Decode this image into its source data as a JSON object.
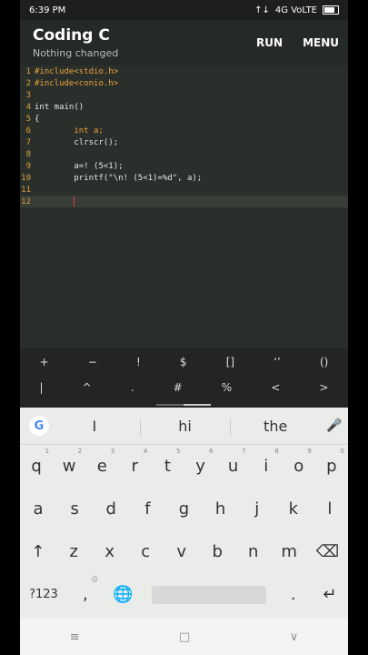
{
  "status": {
    "time": "6:39 PM",
    "network": "4G VoLTE",
    "signal": "↑↓"
  },
  "app": {
    "title": "Coding C",
    "subtitle": "Nothing changed",
    "run_label": "RUN",
    "menu_label": "MENU"
  },
  "editor": {
    "lines": [
      {
        "n": "1",
        "t": "#include<stdio.h>",
        "cls": "pre"
      },
      {
        "n": "2",
        "t": "#include<conio.h>",
        "cls": "pre"
      },
      {
        "n": "3",
        "t": "",
        "cls": "plain"
      },
      {
        "n": "4",
        "t": "int main()",
        "cls": "plain"
      },
      {
        "n": "5",
        "t": "{",
        "cls": "plain"
      },
      {
        "n": "6",
        "t": "        int a;",
        "cls": "kw"
      },
      {
        "n": "7",
        "t": "        clrscr();",
        "cls": "plain"
      },
      {
        "n": "8",
        "t": "",
        "cls": "plain"
      },
      {
        "n": "9",
        "t": "        a=! (5<1);",
        "cls": "plain"
      },
      {
        "n": "10",
        "t": "        printf(\"\\n! (5<1)=%d\", a);",
        "cls": "plain"
      },
      {
        "n": "11",
        "t": "",
        "cls": "plain"
      },
      {
        "n": "12",
        "t": "        ",
        "cls": "plain",
        "active": true
      }
    ]
  },
  "symbols": {
    "row1": [
      "+",
      "−",
      "!",
      "$",
      "[]",
      "‘’",
      "()"
    ],
    "row2": [
      "|",
      "^",
      ".",
      "#",
      "%",
      "<",
      ">"
    ]
  },
  "keyboard": {
    "suggestions": [
      "I",
      "hi",
      "the"
    ],
    "row1": [
      [
        "q",
        "1"
      ],
      [
        "w",
        "2"
      ],
      [
        "e",
        "3"
      ],
      [
        "r",
        "4"
      ],
      [
        "t",
        "5"
      ],
      [
        "y",
        "6"
      ],
      [
        "u",
        "7"
      ],
      [
        "i",
        "8"
      ],
      [
        "o",
        "9"
      ],
      [
        "p",
        "0"
      ]
    ],
    "row2": [
      "a",
      "s",
      "d",
      "f",
      "g",
      "h",
      "j",
      "k",
      "l"
    ],
    "row3": [
      "z",
      "x",
      "c",
      "v",
      "b",
      "n",
      "m"
    ],
    "sym_key": "?123",
    "comma": ",",
    "period": "."
  },
  "icons": {
    "google": "G",
    "mic": "🎤",
    "shift": "↑",
    "backspace": "⌫",
    "emoji": "☺",
    "globe": "🌐",
    "enter": "↵",
    "nav_menu": "≡",
    "nav_home": "□",
    "nav_back": "∨"
  }
}
